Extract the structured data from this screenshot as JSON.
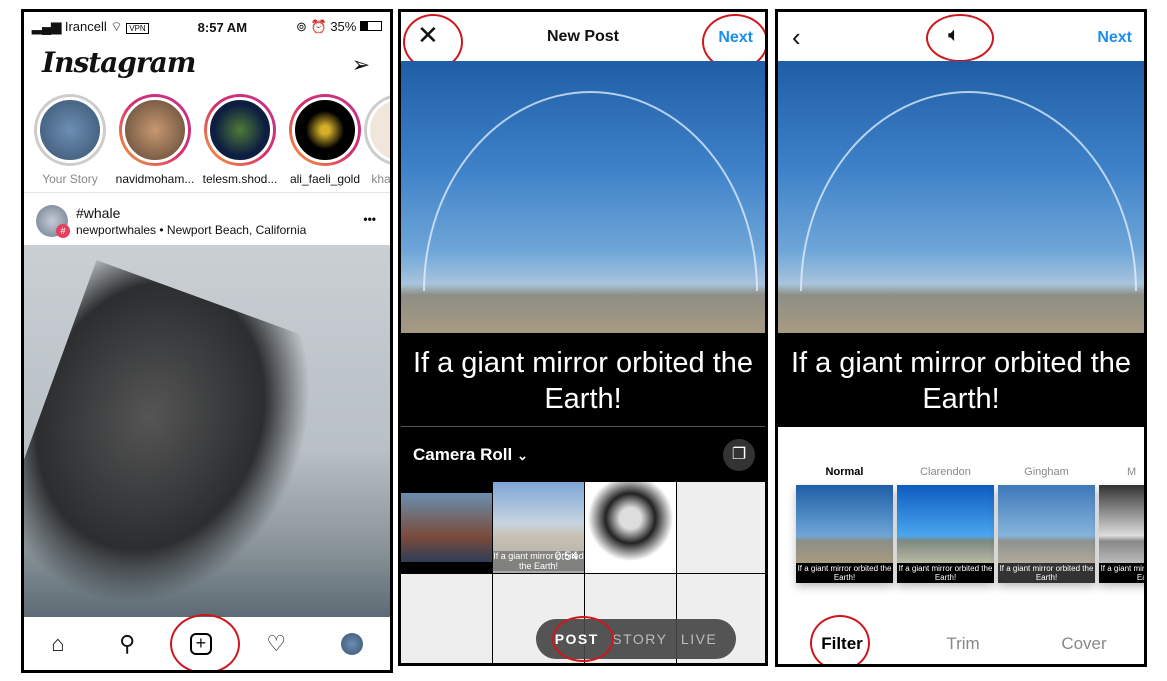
{
  "feed": {
    "status": {
      "carrier": "Irancell",
      "vpn": "VPN",
      "time": "8:57 AM",
      "battery": "35%"
    },
    "logo": "Instagram",
    "stories": [
      {
        "label": "Your Story"
      },
      {
        "label": "navidmoham..."
      },
      {
        "label": "telesm.shod..."
      },
      {
        "label": "ali_faeli_gold"
      },
      {
        "label": "khay"
      }
    ],
    "post": {
      "title": "#whale",
      "subtitle": "newportwhales • Newport Beach, California",
      "more": "•••"
    },
    "nav": [
      "home-icon",
      "search-icon",
      "add-post-icon",
      "heart-icon",
      "profile-avatar"
    ]
  },
  "new_post": {
    "title": "New Post",
    "next": "Next",
    "caption": "If a giant mirror orbited the Earth!",
    "album": "Camera Roll",
    "album_chevron": "⌄",
    "video_duration": "0:54",
    "thumb_caption": "If a giant mirror orbited the Earth!",
    "modes": [
      "POST",
      "STORY",
      "LIVE"
    ]
  },
  "edit": {
    "next": "Next",
    "caption": "If a giant mirror orbited the Earth!",
    "filters": [
      {
        "name": "Normal"
      },
      {
        "name": "Clarendon"
      },
      {
        "name": "Gingham"
      },
      {
        "name": "M"
      }
    ],
    "thumb_caption": "If a giant mirror orbited the Earth!",
    "tabs": [
      "Filter",
      "Trim",
      "Cover"
    ]
  },
  "colors": {
    "accent": "#1a8ff0",
    "highlight_circle": "#d0161d"
  }
}
